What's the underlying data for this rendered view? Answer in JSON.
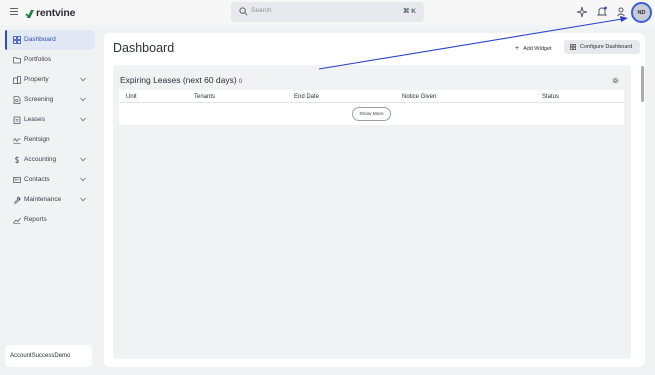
{
  "app": {
    "brand": "rentvine",
    "brand_color": "#2e4fb8"
  },
  "topbar": {
    "search_placeholder": "Search",
    "search_shortcut": "⌘ K",
    "icons": [
      "menu-icon",
      "sparkle-icon",
      "bell-icon",
      "person-icon"
    ],
    "avatar_initials": "ND"
  },
  "sidebar": {
    "items": [
      {
        "label": "Dashboard",
        "icon": "grid-icon",
        "active": true
      },
      {
        "label": "Portfolios",
        "icon": "folder-icon"
      },
      {
        "label": "Property",
        "icon": "building-icon",
        "expandable": true
      },
      {
        "label": "Screening",
        "icon": "document-search-icon",
        "expandable": true
      },
      {
        "label": "Leases",
        "icon": "clipboard-icon",
        "expandable": true
      },
      {
        "label": "Rentsign",
        "icon": "signature-icon"
      },
      {
        "label": "Accounting",
        "icon": "dollar-icon",
        "expandable": true
      },
      {
        "label": "Contacts",
        "icon": "contact-card-icon",
        "expandable": true
      },
      {
        "label": "Maintenance",
        "icon": "wrench-icon",
        "expandable": true
      },
      {
        "label": "Reports",
        "icon": "chart-icon"
      }
    ],
    "account_name": "AccountSuccessDemo"
  },
  "main": {
    "title": "Dashboard",
    "add_widget_label": "Add Widget",
    "configure_label": "Configure Dashboard",
    "widget": {
      "title": "Expiring Leases (next 60 days)",
      "count": "0",
      "columns": [
        "Unit",
        "Tenants",
        "End Date",
        "Notice Given",
        "Status"
      ],
      "show_more_label": "Show More"
    }
  },
  "annotation": {
    "arrow_color": "#2a44c9"
  }
}
